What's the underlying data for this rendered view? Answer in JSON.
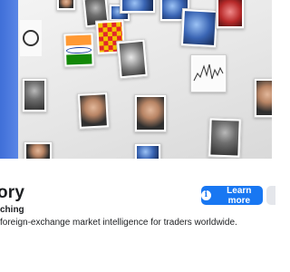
{
  "page": {
    "name_partial": "ory",
    "category_partial": "ching",
    "description_partial": "foreign-exchange market intelligence for traders worldwide."
  },
  "actions": {
    "learn_more_label": "Learn more",
    "learn_more_icon": "info-icon"
  },
  "colors": {
    "primary_button": "#1877f2",
    "accent_strip": "#4a78df"
  }
}
